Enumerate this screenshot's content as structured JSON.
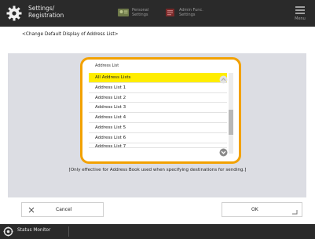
{
  "header": {
    "title_line1": "Settings/",
    "title_line2": "Registration",
    "btn1_line1": "Personal",
    "btn1_line2": "Settings",
    "btn2_line1": "Admin Func.",
    "btn2_line2": "Settings",
    "menu_label": "Menu"
  },
  "subtitle": "<Change Default Display of Address List>",
  "listbox": {
    "header": "Address List",
    "items": [
      "All Address Lists",
      "Address List 1",
      "Address List 2",
      "Address List 3",
      "Address List 4",
      "Address List 5",
      "Address List 6",
      "Address List 7"
    ],
    "selected_index": 0
  },
  "note": "[Only effective for Address Book used when specifying destinations for sending.]",
  "buttons": {
    "cancel": "Cancel",
    "ok": "OK"
  },
  "footer": {
    "status_monitor": "Status Monitor"
  },
  "colors": {
    "accent": "#f2a100",
    "selected": "#ffed00",
    "panel": "#dcdde3",
    "bar": "#2a2a2a"
  }
}
